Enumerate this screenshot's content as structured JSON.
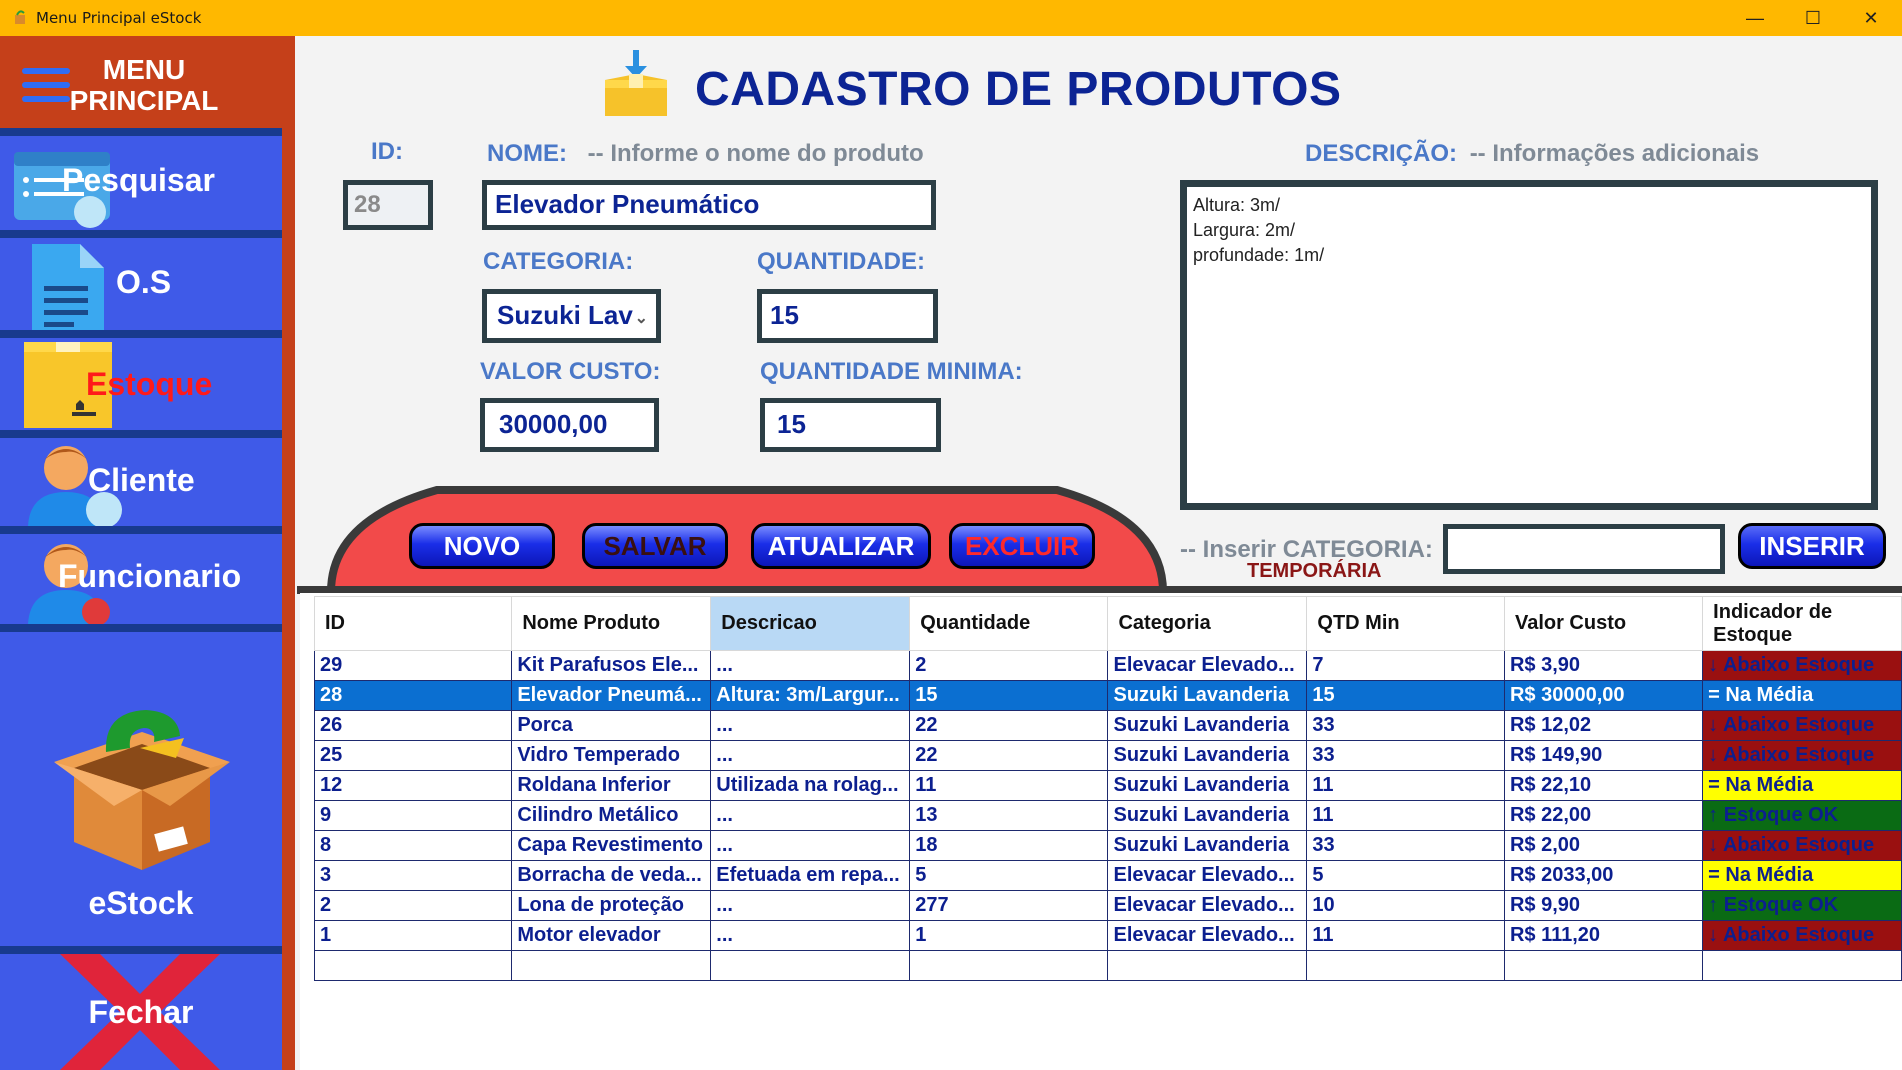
{
  "window": {
    "title": "Menu Principal eStock",
    "minimize": "—",
    "maximize": "☐",
    "close": "✕"
  },
  "sidebar": {
    "menu_label": "MENU PRINCIPAL",
    "items": [
      {
        "label": "Pesquisar",
        "icon": "search-list-icon"
      },
      {
        "label": "O.S",
        "icon": "document-icon"
      },
      {
        "label": "Estoque",
        "icon": "box-icon",
        "active": true
      },
      {
        "label": "Cliente",
        "icon": "user-icon"
      },
      {
        "label": "Funcionario",
        "icon": "employee-icon"
      }
    ],
    "brand_label": "eStock",
    "close_label": "Fechar"
  },
  "form": {
    "title": "CADASTRO DE PRODUTOS",
    "id_label": "ID:",
    "id_value": "28",
    "nome_label": "NOME:",
    "nome_hint": "-- Informe o nome do produto",
    "nome_value": "Elevador Pneumático",
    "categoria_label": "CATEGORIA:",
    "categoria_value": "Suzuki Lav",
    "quantidade_label": "QUANTIDADE:",
    "quantidade_value": "15",
    "valor_custo_label": "VALOR CUSTO:",
    "valor_custo_value": "30000,00",
    "qtd_min_label": "QUANTIDADE MINIMA:",
    "qtd_min_value": "15",
    "descricao_label": "DESCRIÇÃO:",
    "descricao_hint": "-- Informações adicionais",
    "descricao_value": "Altura: 3m/\nLargura: 2m/\nprofundade: 1m/",
    "inserir_cat_label": "-- Inserir CATEGORIA:",
    "temporaria_label": "TEMPORÁRIA",
    "inserir_cat_value": "",
    "buttons": {
      "novo": "NOVO",
      "salvar": "SALVAR",
      "atualizar": "ATUALIZAR",
      "excluir": "EXCLUIR",
      "inserir": "INSERIR"
    }
  },
  "table": {
    "columns": [
      "ID",
      "Nome Produto",
      "Descricao",
      "Quantidade",
      "Categoria",
      "QTD Min",
      "Valor Custo",
      "Indicador de Estoque"
    ],
    "rows": [
      [
        "29",
        "Kit Parafusos Ele...",
        "...",
        "2",
        "Elevacar Elevado...",
        "7",
        "R$ 3,90",
        "↓ Abaixo Estoque"
      ],
      [
        "28",
        "Elevador Pneumá...",
        "Altura: 3m/Largur...",
        "15",
        "Suzuki Lavanderia",
        "15",
        "R$ 30000,00",
        "= Na Média"
      ],
      [
        "26",
        "Porca",
        "...",
        "22",
        "Suzuki Lavanderia",
        "33",
        "R$ 12,02",
        "↓ Abaixo Estoque"
      ],
      [
        "25",
        "Vidro Temperado",
        "...",
        "22",
        "Suzuki Lavanderia",
        "33",
        "R$ 149,90",
        "↓ Abaixo Estoque"
      ],
      [
        "12",
        "Roldana Inferior",
        "Utilizada na rolag...",
        "11",
        "Suzuki Lavanderia",
        "11",
        "R$ 22,10",
        "= Na Média"
      ],
      [
        "9",
        "Cilindro Metálico",
        "...",
        "13",
        "Suzuki Lavanderia",
        "11",
        "R$ 22,00",
        "↑ Estoque OK"
      ],
      [
        "8",
        "Capa Revestimento",
        "...",
        "18",
        "Suzuki Lavanderia",
        "33",
        "R$ 2,00",
        "↓ Abaixo Estoque"
      ],
      [
        "3",
        "Borracha de veda...",
        "Efetuada em repa...",
        "5",
        "Elevacar Elevado...",
        "5",
        "R$ 2033,00",
        "= Na Média"
      ],
      [
        "2",
        "Lona de proteção",
        "...",
        "277",
        "Elevacar Elevado...",
        "10",
        "R$ 9,90",
        "↑ Estoque OK"
      ],
      [
        "1",
        "Motor elevador",
        "...",
        "1",
        "Elevacar Elevado...",
        "11",
        "R$ 111,20",
        "↓ Abaixo Estoque"
      ]
    ],
    "selected_row": 1,
    "sorted_column": 2
  },
  "colors": {
    "titlebar": "#ffb800",
    "sidebar": "#3f5ae8",
    "sidebar_border": "#c5401a",
    "title_text": "#0c2494",
    "selected_row": "#0b6fd1",
    "below": "#9a1010",
    "average": "#ffff00",
    "ok": "#0a6b14"
  }
}
